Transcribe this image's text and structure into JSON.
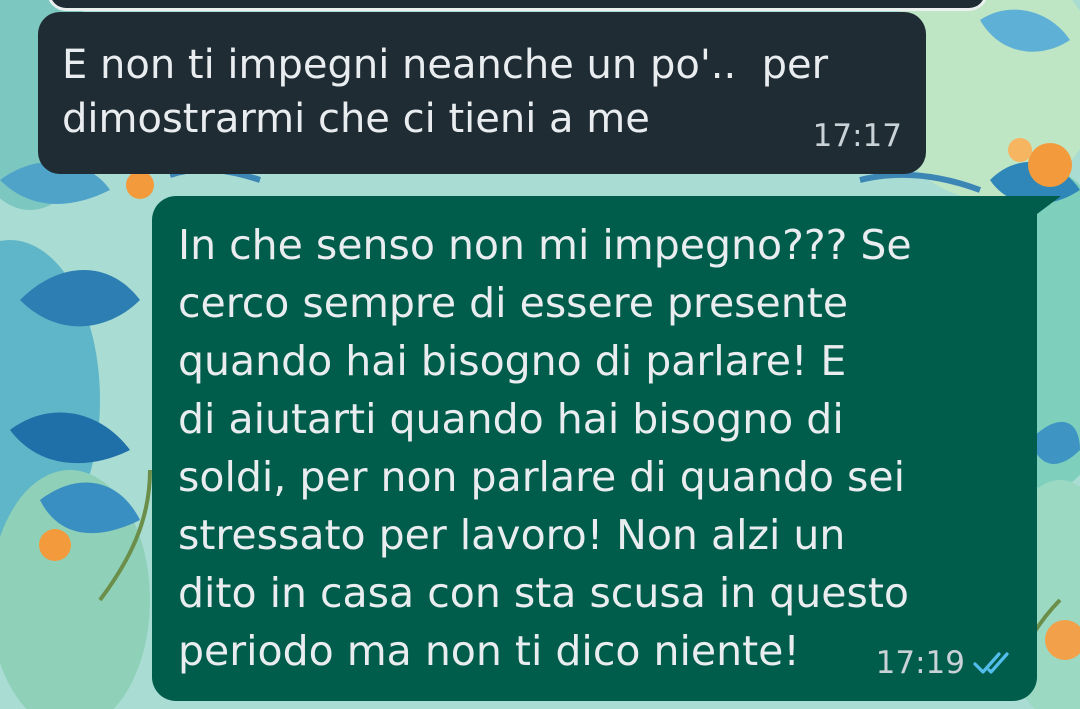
{
  "chat": {
    "messages": [
      {
        "direction": "incoming",
        "text": "E non ti impegni neanche un po'..  per\ndimostrarmi che ci tieni a me",
        "time": "17:17"
      },
      {
        "direction": "outgoing",
        "text": "In che senso non mi impegno??? Se\ncerco sempre di essere presente\nquando hai bisogno di parlare! E\ndi aiutarti quando hai bisogno di\nsoldi, per non parlare di quando sei\nstressato per lavoro! Non alzi un\ndito in casa con sta scusa in questo\nperiodo ma non ti dico niente!",
        "time": "17:19",
        "status_icon": "double-check-read-icon"
      }
    ]
  },
  "colors": {
    "incoming_bubble": "#1f2c34",
    "outgoing_bubble": "#005c4b",
    "read_check": "#53bdeb",
    "wallpaper_base": "#9fd6cf"
  }
}
